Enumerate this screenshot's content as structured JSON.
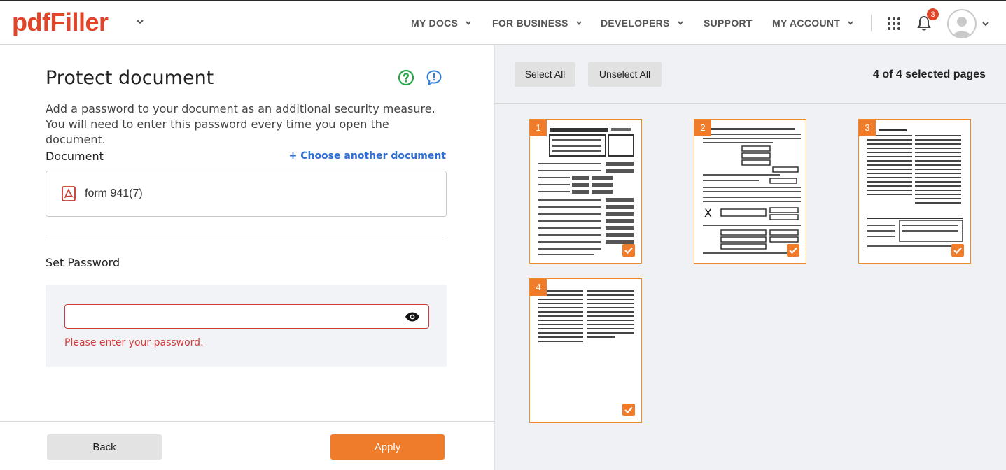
{
  "header": {
    "logo": "pdfFiller",
    "nav": [
      {
        "label": "MY DOCS",
        "has_chevron": true
      },
      {
        "label": "FOR BUSINESS",
        "has_chevron": true
      },
      {
        "label": "DEVELOPERS",
        "has_chevron": true
      },
      {
        "label": "SUPPORT",
        "has_chevron": false
      },
      {
        "label": "MY ACCOUNT",
        "has_chevron": true
      }
    ],
    "notification_count": "3",
    "icons": [
      "chevron-down-icon",
      "apps-grid-icon",
      "bell-icon",
      "avatar-icon"
    ]
  },
  "left": {
    "title": "Protect document",
    "description": "Add a password to your document as an additional security measure. You will need to enter this password every time you open the document.",
    "document_label": "Document",
    "choose_link": "+ Choose another document",
    "document_name": "form 941(7)",
    "set_password_label": "Set Password",
    "password_value": "",
    "password_error": "Please enter your password.",
    "back_label": "Back",
    "apply_label": "Apply"
  },
  "right": {
    "select_all_label": "Select All",
    "unselect_all_label": "Unselect All",
    "selected_count": "4 of 4 selected pages",
    "pages": [
      {
        "number": "1",
        "selected": true
      },
      {
        "number": "2",
        "selected": true
      },
      {
        "number": "3",
        "selected": true
      },
      {
        "number": "4",
        "selected": true
      }
    ]
  },
  "colors": {
    "brand": "#e0452a",
    "accent": "#ef7c2a",
    "link": "#2f6fd0",
    "error": "#d23b3b",
    "help_green": "#2aa54a",
    "chat_blue": "#2f7fd6"
  }
}
